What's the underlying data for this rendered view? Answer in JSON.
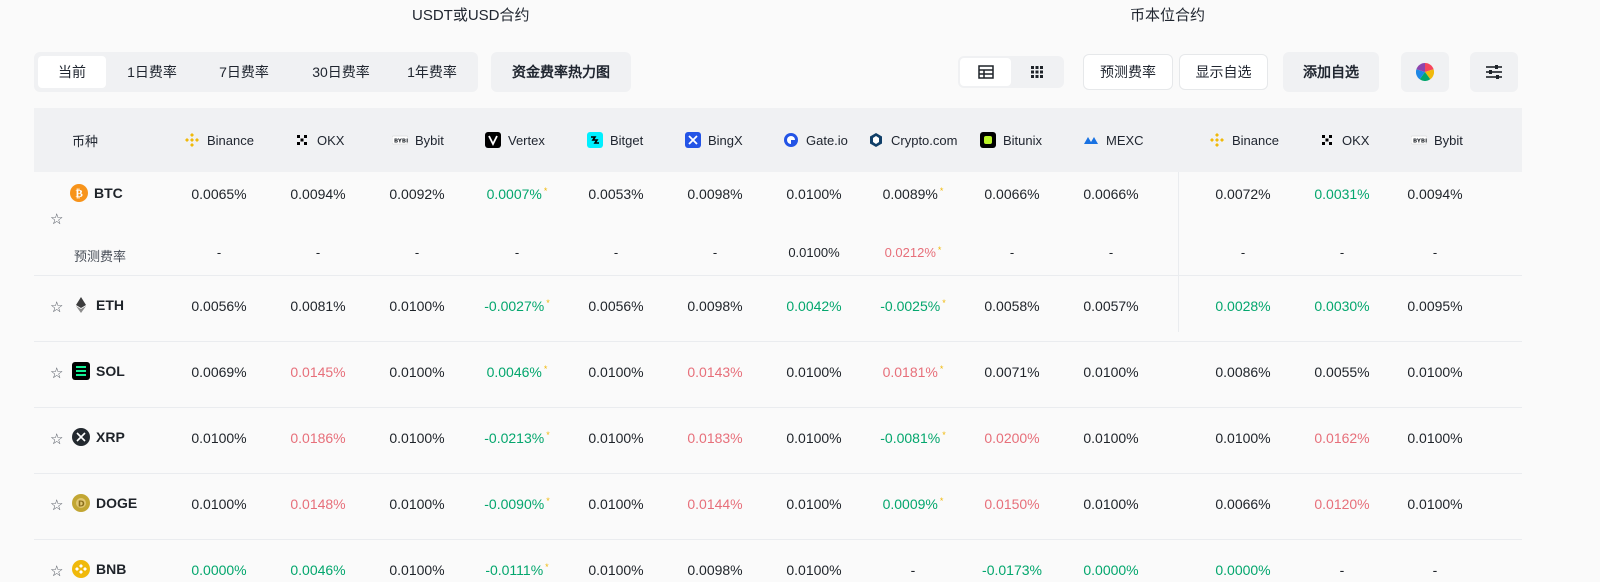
{
  "sections": {
    "usdt": "USDT或USD合约",
    "coin": "币本位合约"
  },
  "tabs": [
    "当前",
    "1日费率",
    "7日费率",
    "30日费率",
    "1年费率"
  ],
  "active_tab": 0,
  "heatmap_label": "资金费率热力图",
  "predicted_label": "预测费率",
  "show_self_label": "显示自选",
  "add_self_label": "添加自选",
  "colors": {
    "green": "#03a66d",
    "red": "#f6465d",
    "accent": "#f0b90b"
  },
  "header": {
    "coin_col": "币种",
    "exchanges": [
      "Binance",
      "OKX",
      "Bybit",
      "Vertex",
      "Bitget",
      "BingX",
      "Gate.io",
      "Crypto.com",
      "Bitunix",
      "MEXC",
      "Binance",
      "OKX",
      "Bybit"
    ]
  },
  "rows": [
    {
      "symbol": "BTC",
      "coin_icon": "btc-coin-icon",
      "values": [
        "0.0065%",
        "0.0094%",
        "0.0092%",
        "0.0007%",
        "0.0053%",
        "0.0098%",
        "0.0100%",
        "0.0089%",
        "0.0066%",
        "0.0066%",
        "0.0072%",
        "0.0031%",
        "0.0094%"
      ],
      "colors": [
        "k",
        "k",
        "k",
        "g",
        "k",
        "k",
        "k",
        "k",
        "k",
        "k",
        "k",
        "g",
        "k"
      ],
      "stars": [
        3,
        7
      ],
      "predicted": [
        "-",
        "-",
        "-",
        "-",
        "-",
        "-",
        "0.0100%",
        "0.0212%",
        "-",
        "-",
        "-",
        "-",
        "-"
      ],
      "predicted_colors": [
        "k",
        "k",
        "k",
        "k",
        "k",
        "k",
        "k",
        "r",
        "k",
        "k",
        "k",
        "k",
        "k"
      ],
      "predicted_stars": [
        7
      ]
    },
    {
      "symbol": "ETH",
      "coin_icon": "eth-coin-icon",
      "values": [
        "0.0056%",
        "0.0081%",
        "0.0100%",
        "-0.0027%",
        "0.0056%",
        "0.0098%",
        "0.0042%",
        "-0.0025%",
        "0.0058%",
        "0.0057%",
        "0.0028%",
        "0.0030%",
        "0.0095%"
      ],
      "colors": [
        "k",
        "k",
        "k",
        "g",
        "k",
        "k",
        "g",
        "g",
        "k",
        "k",
        "g",
        "g",
        "k"
      ],
      "stars": [
        3,
        7
      ]
    },
    {
      "symbol": "SOL",
      "coin_icon": "sol-coin-icon",
      "values": [
        "0.0069%",
        "0.0145%",
        "0.0100%",
        "0.0046%",
        "0.0100%",
        "0.0143%",
        "0.0100%",
        "0.0181%",
        "0.0071%",
        "0.0100%",
        "0.0086%",
        "0.0055%",
        "0.0100%"
      ],
      "colors": [
        "k",
        "r",
        "k",
        "g",
        "k",
        "r",
        "k",
        "r",
        "k",
        "k",
        "k",
        "k",
        "k"
      ],
      "stars": [
        3,
        7
      ]
    },
    {
      "symbol": "XRP",
      "coin_icon": "xrp-coin-icon",
      "values": [
        "0.0100%",
        "0.0186%",
        "0.0100%",
        "-0.0213%",
        "0.0100%",
        "0.0183%",
        "0.0100%",
        "-0.0081%",
        "0.0200%",
        "0.0100%",
        "0.0100%",
        "0.0162%",
        "0.0100%"
      ],
      "colors": [
        "k",
        "r",
        "k",
        "g",
        "k",
        "r",
        "k",
        "g",
        "r",
        "k",
        "k",
        "r",
        "k"
      ],
      "stars": [
        3,
        7
      ]
    },
    {
      "symbol": "DOGE",
      "coin_icon": "doge-coin-icon",
      "values": [
        "0.0100%",
        "0.0148%",
        "0.0100%",
        "-0.0090%",
        "0.0100%",
        "0.0144%",
        "0.0100%",
        "0.0009%",
        "0.0150%",
        "0.0100%",
        "0.0066%",
        "0.0120%",
        "0.0100%"
      ],
      "colors": [
        "k",
        "r",
        "k",
        "g",
        "k",
        "r",
        "k",
        "g",
        "r",
        "k",
        "k",
        "r",
        "k"
      ],
      "stars": [
        3,
        7
      ]
    },
    {
      "symbol": "BNB",
      "coin_icon": "bnb-coin-icon",
      "values": [
        "0.0000%",
        "0.0046%",
        "0.0100%",
        "-0.0111%",
        "0.0100%",
        "0.0098%",
        "0.0100%",
        "-",
        "-0.0173%",
        "0.0000%",
        "0.0000%",
        "-",
        "-"
      ],
      "colors": [
        "g",
        "g",
        "k",
        "g",
        "k",
        "k",
        "k",
        "k",
        "g",
        "g",
        "g",
        "k",
        "k"
      ],
      "stars": [
        3
      ]
    }
  ]
}
